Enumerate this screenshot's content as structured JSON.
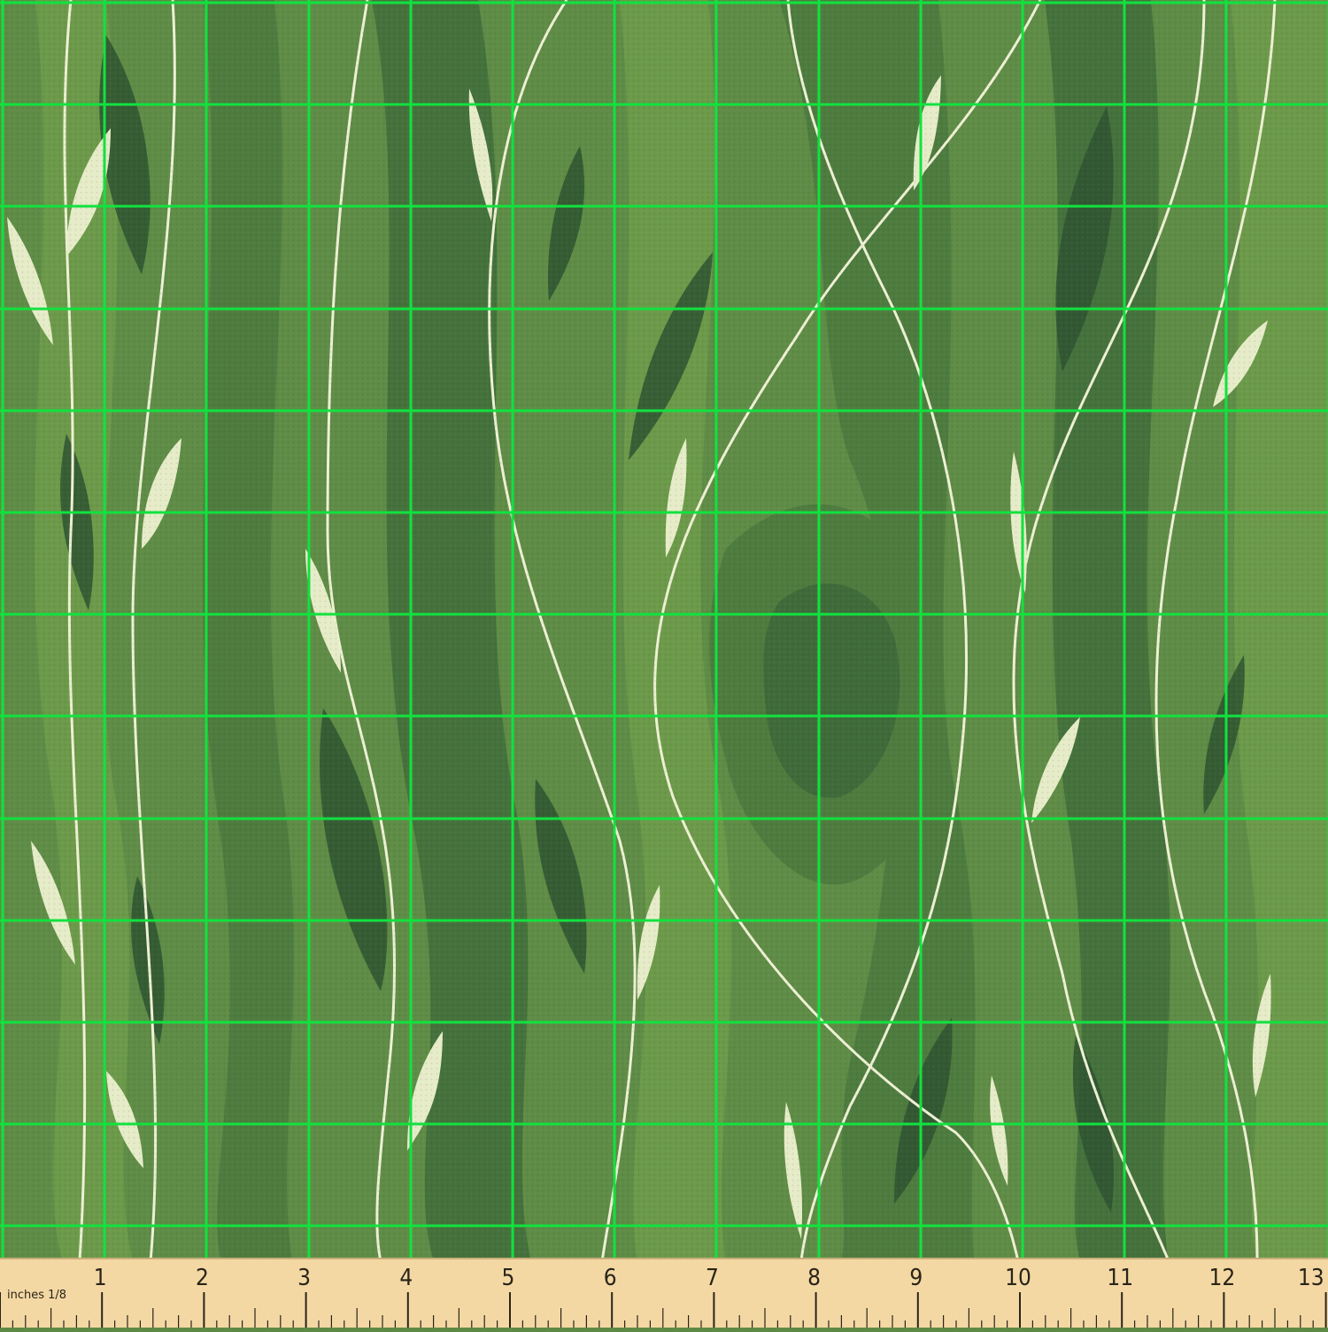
{
  "fabric": {
    "pattern": "green wavy leaves and vines",
    "colors": {
      "base": "#5f8c46",
      "band_dark": "#3f6b3a",
      "band_mid": "#4e7c3f",
      "band_light": "#6c9a4a",
      "leaf_dark": "#2f5331",
      "leaf_cream": "#e6ecc8",
      "vine": "#eef0d4",
      "grid": "#11e23f",
      "ruler": "#f3d8a4",
      "ruler_ink": "#2a2418"
    }
  },
  "ruler": {
    "units_label": "inches 1/8",
    "tick_labels": [
      "1",
      "2",
      "3",
      "4",
      "5",
      "6",
      "7",
      "8",
      "9",
      "10",
      "11",
      "12",
      "13"
    ]
  }
}
